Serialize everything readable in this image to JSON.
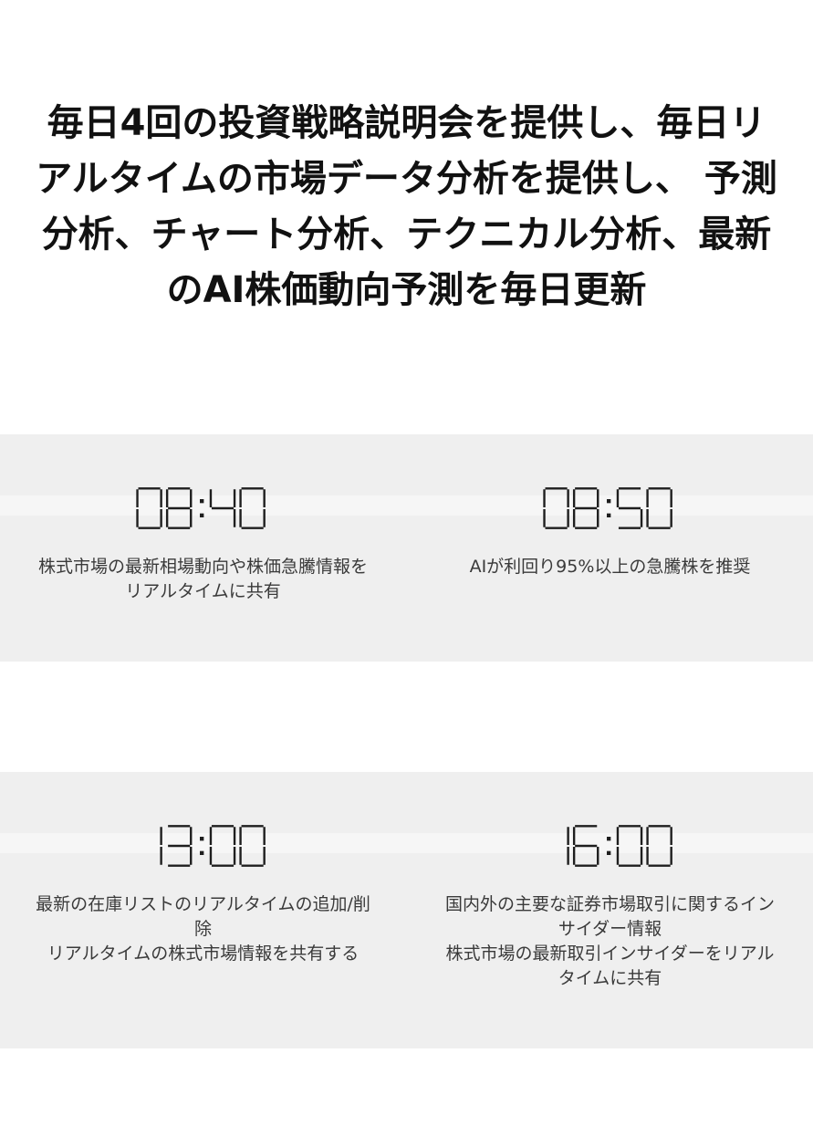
{
  "headline": {
    "line1": "毎日4回の投資戦略説明会を提供し、毎日リ",
    "line2": "アルタイムの市場データ分析を提供し、 予測",
    "line3": "分析、チャート分析、テクニカル分析、最新",
    "line4": "のAI株価動向予測を毎日更新"
  },
  "sessions": [
    {
      "time": "08:40",
      "lines": [
        "株式市場の最新相場動向や株価急騰情報を",
        "リアルタイムに共有"
      ]
    },
    {
      "time": "08:50",
      "lines": [
        "AIが利回り95%以上の急騰株を推奨"
      ]
    },
    {
      "time": "13:00",
      "lines": [
        "最新の在庫リストのリアルタイムの追加/削",
        "除",
        "リアルタイムの株式市場情報を共有する"
      ]
    },
    {
      "time": "16:00",
      "lines": [
        "国内外の主要な証券市場取引に関するイン",
        "サイダー情報",
        "株式市場の最新取引インサイダーをリアル",
        "タイムに共有"
      ]
    }
  ]
}
